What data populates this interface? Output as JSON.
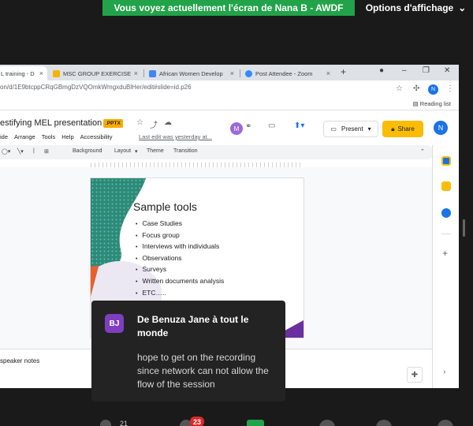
{
  "zoom": {
    "share_banner": "Vous voyez actuellement l'écran de Nana B - AWDF",
    "view_options": "Options d'affichage",
    "chat_badge": "23",
    "participants_count": "21"
  },
  "browser": {
    "tabs": [
      {
        "label": "L training - D",
        "favicon_color": "#f4b400",
        "active": true
      },
      {
        "label": "MSC GROUP EXERCISE - G",
        "favicon_color": "#f4b400",
        "active": false
      },
      {
        "label": "African Women Develop",
        "favicon_color": "#4285f4",
        "active": false
      },
      {
        "label": "Post Attendee - Zoom",
        "favicon_color": "#2d8cff",
        "active": false
      }
    ],
    "url": "on/d/1E9btcppCRqGBmgDzVQOmkWmgxduBlHer/edit#slide=id.p26",
    "reading_list": "Reading list",
    "profile_initial": "N"
  },
  "slides": {
    "title": "estifying MEL presentation",
    "format_badge": ".PPTX",
    "menu": [
      "ide",
      "Arrange",
      "Tools",
      "Help",
      "Accessibility"
    ],
    "last_edit": "Last edit was yesterday at...",
    "collaborator_initial": "M",
    "present_label": "Present",
    "share_label": "Share",
    "user_initial": "N",
    "edit_toolbar": {
      "background": "Background",
      "layout": "Layout",
      "theme": "Theme",
      "transition": "Transition"
    },
    "slide": {
      "title": "Sample tools",
      "bullets": [
        "Case Studies",
        "Focus group",
        "Interviews with individuals",
        "Observations",
        "Surveys",
        "Written documents analysis",
        "ETC….."
      ]
    },
    "speaker_notes": "speaker notes"
  },
  "chat": {
    "avatar_initials": "BJ",
    "from": "De Benuza Jane à tout le monde",
    "message": "hope to get on the recording since network can not allow the flow of the session"
  }
}
